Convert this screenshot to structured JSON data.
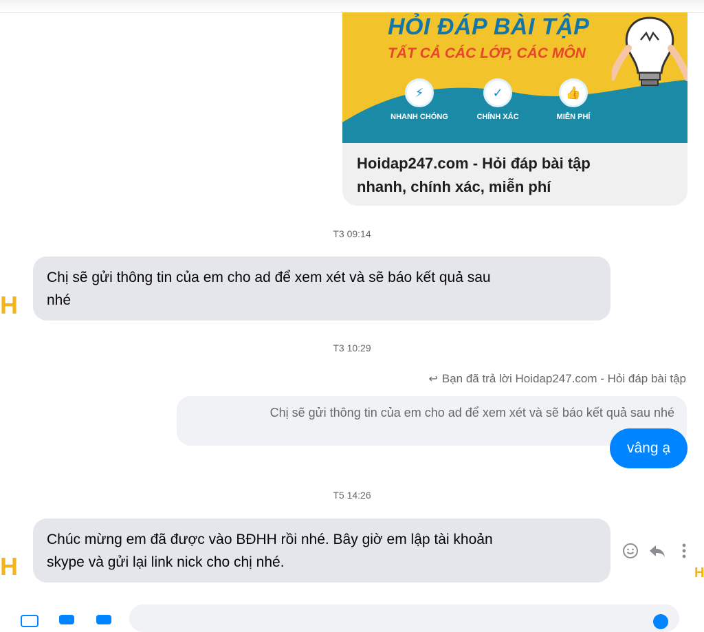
{
  "link_card": {
    "banner_title": "HỎI ĐÁP BÀI TẬP",
    "banner_subtitle": "TẤT CẢ CÁC LỚP, CÁC MÔN",
    "features": [
      "NHANH CHÓNG",
      "CHÍNH XÁC",
      "MIỄN PHÍ"
    ],
    "title_line1": "Hoidap247.com - Hỏi đáp bài tập",
    "title_line2": "nhanh, chính xác, miễn phí"
  },
  "timestamps": [
    "T3 09:14",
    "T3 10:29",
    "T5 14:26"
  ],
  "messages": {
    "incoming_1_line1": "Chị sẽ gửi thông tin của em cho ad để xem xét và sẽ báo kết quả sau",
    "incoming_1_line2": "nhé",
    "reply_note": "Bạn đã trả lời Hoidap247.com - Hỏi đáp bài tập",
    "quoted_text": "Chị sẽ gửi thông tin của em cho ad để xem xét và sẽ báo kết quả sau nhé",
    "outgoing_1": "vâng ạ",
    "incoming_2_line1": "Chúc mừng em đã được vào BĐHH rồi nhé. Bây giờ em lập tài khoản",
    "incoming_2_line2": "skype và gửi lại link nick cho chị nhé."
  },
  "avatar_letter": "H",
  "icons": {
    "reply": "reply-arrow-icon",
    "react": "smiley-icon",
    "more": "more-vertical-icon"
  },
  "colors": {
    "outgoing_bubble": "#0084ff",
    "incoming_bubble": "#e4e6eb",
    "banner_yellow": "#f3c32c",
    "banner_teal": "#1a8aa6"
  }
}
